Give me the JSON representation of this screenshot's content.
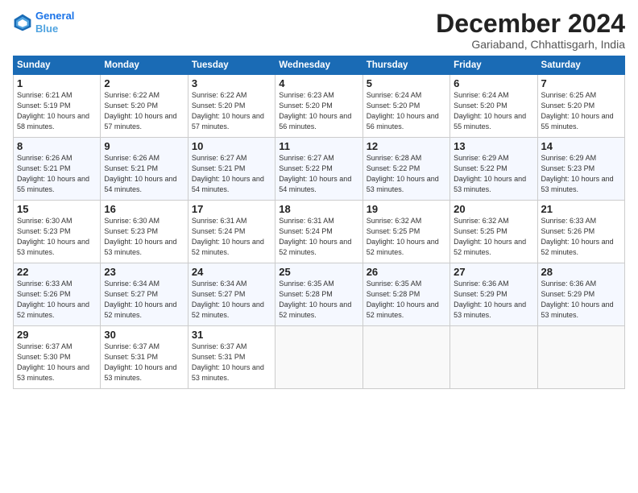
{
  "logo": {
    "line1": "General",
    "line2": "Blue"
  },
  "title": "December 2024",
  "location": "Gariaband, Chhattisgarh, India",
  "weekdays": [
    "Sunday",
    "Monday",
    "Tuesday",
    "Wednesday",
    "Thursday",
    "Friday",
    "Saturday"
  ],
  "weeks": [
    [
      {
        "day": "1",
        "rise": "6:21 AM",
        "set": "5:19 PM",
        "dl": "10 hours and 58 minutes."
      },
      {
        "day": "2",
        "rise": "6:22 AM",
        "set": "5:20 PM",
        "dl": "10 hours and 57 minutes."
      },
      {
        "day": "3",
        "rise": "6:22 AM",
        "set": "5:20 PM",
        "dl": "10 hours and 57 minutes."
      },
      {
        "day": "4",
        "rise": "6:23 AM",
        "set": "5:20 PM",
        "dl": "10 hours and 56 minutes."
      },
      {
        "day": "5",
        "rise": "6:24 AM",
        "set": "5:20 PM",
        "dl": "10 hours and 56 minutes."
      },
      {
        "day": "6",
        "rise": "6:24 AM",
        "set": "5:20 PM",
        "dl": "10 hours and 55 minutes."
      },
      {
        "day": "7",
        "rise": "6:25 AM",
        "set": "5:20 PM",
        "dl": "10 hours and 55 minutes."
      }
    ],
    [
      {
        "day": "8",
        "rise": "6:26 AM",
        "set": "5:21 PM",
        "dl": "10 hours and 55 minutes."
      },
      {
        "day": "9",
        "rise": "6:26 AM",
        "set": "5:21 PM",
        "dl": "10 hours and 54 minutes."
      },
      {
        "day": "10",
        "rise": "6:27 AM",
        "set": "5:21 PM",
        "dl": "10 hours and 54 minutes."
      },
      {
        "day": "11",
        "rise": "6:27 AM",
        "set": "5:22 PM",
        "dl": "10 hours and 54 minutes."
      },
      {
        "day": "12",
        "rise": "6:28 AM",
        "set": "5:22 PM",
        "dl": "10 hours and 53 minutes."
      },
      {
        "day": "13",
        "rise": "6:29 AM",
        "set": "5:22 PM",
        "dl": "10 hours and 53 minutes."
      },
      {
        "day": "14",
        "rise": "6:29 AM",
        "set": "5:23 PM",
        "dl": "10 hours and 53 minutes."
      }
    ],
    [
      {
        "day": "15",
        "rise": "6:30 AM",
        "set": "5:23 PM",
        "dl": "10 hours and 53 minutes."
      },
      {
        "day": "16",
        "rise": "6:30 AM",
        "set": "5:23 PM",
        "dl": "10 hours and 53 minutes."
      },
      {
        "day": "17",
        "rise": "6:31 AM",
        "set": "5:24 PM",
        "dl": "10 hours and 52 minutes."
      },
      {
        "day": "18",
        "rise": "6:31 AM",
        "set": "5:24 PM",
        "dl": "10 hours and 52 minutes."
      },
      {
        "day": "19",
        "rise": "6:32 AM",
        "set": "5:25 PM",
        "dl": "10 hours and 52 minutes."
      },
      {
        "day": "20",
        "rise": "6:32 AM",
        "set": "5:25 PM",
        "dl": "10 hours and 52 minutes."
      },
      {
        "day": "21",
        "rise": "6:33 AM",
        "set": "5:26 PM",
        "dl": "10 hours and 52 minutes."
      }
    ],
    [
      {
        "day": "22",
        "rise": "6:33 AM",
        "set": "5:26 PM",
        "dl": "10 hours and 52 minutes."
      },
      {
        "day": "23",
        "rise": "6:34 AM",
        "set": "5:27 PM",
        "dl": "10 hours and 52 minutes."
      },
      {
        "day": "24",
        "rise": "6:34 AM",
        "set": "5:27 PM",
        "dl": "10 hours and 52 minutes."
      },
      {
        "day": "25",
        "rise": "6:35 AM",
        "set": "5:28 PM",
        "dl": "10 hours and 52 minutes."
      },
      {
        "day": "26",
        "rise": "6:35 AM",
        "set": "5:28 PM",
        "dl": "10 hours and 52 minutes."
      },
      {
        "day": "27",
        "rise": "6:36 AM",
        "set": "5:29 PM",
        "dl": "10 hours and 53 minutes."
      },
      {
        "day": "28",
        "rise": "6:36 AM",
        "set": "5:29 PM",
        "dl": "10 hours and 53 minutes."
      }
    ],
    [
      {
        "day": "29",
        "rise": "6:37 AM",
        "set": "5:30 PM",
        "dl": "10 hours and 53 minutes."
      },
      {
        "day": "30",
        "rise": "6:37 AM",
        "set": "5:31 PM",
        "dl": "10 hours and 53 minutes."
      },
      {
        "day": "31",
        "rise": "6:37 AM",
        "set": "5:31 PM",
        "dl": "10 hours and 53 minutes."
      },
      null,
      null,
      null,
      null
    ]
  ]
}
